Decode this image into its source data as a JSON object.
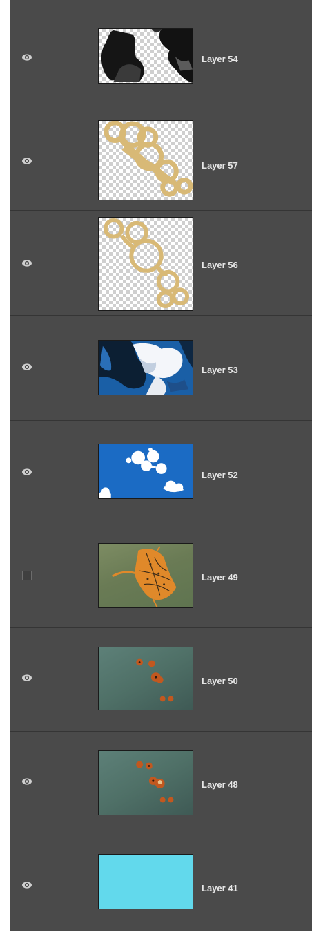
{
  "panel": {
    "background": "#4a4a4a",
    "divider": "#353535"
  },
  "layers": [
    {
      "name": "Layer 54",
      "visible": true,
      "thumb": "mask-bw"
    },
    {
      "name": "Layer 57",
      "visible": true,
      "thumb": "gold-rings-filled"
    },
    {
      "name": "Layer 56",
      "visible": true,
      "thumb": "gold-rings-outline"
    },
    {
      "name": "Layer 53",
      "visible": true,
      "thumb": "blue-dark-clouds"
    },
    {
      "name": "Layer 52",
      "visible": true,
      "thumb": "blue-white-spots"
    },
    {
      "name": "Layer 49",
      "visible": false,
      "thumb": "green-orange-map"
    },
    {
      "name": "Layer 50",
      "visible": true,
      "thumb": "teal-orange-dots"
    },
    {
      "name": "Layer 48",
      "visible": true,
      "thumb": "teal-orange-cluster"
    },
    {
      "name": "Layer 41",
      "visible": true,
      "thumb": "solid-cyan",
      "color": "#62d9ec"
    }
  ],
  "icons": {
    "visible": "eye-icon",
    "hidden": "visibility-box"
  }
}
